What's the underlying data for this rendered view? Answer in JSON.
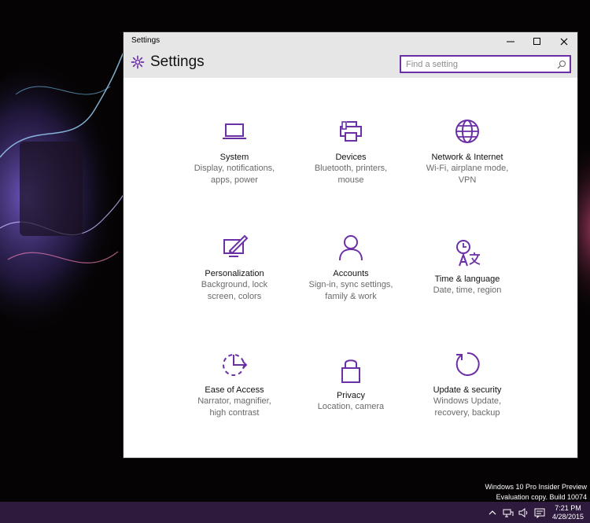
{
  "window": {
    "title": "Settings",
    "header_title": "Settings",
    "search_placeholder": "Find a setting",
    "controls": [
      "minimize-icon",
      "maximize-icon",
      "close-icon"
    ]
  },
  "tiles": [
    {
      "name": "System",
      "desc1": "Display, notifications,",
      "desc2": "apps, power",
      "icon": "laptop-icon"
    },
    {
      "name": "Devices",
      "desc1": "Bluetooth, printers,",
      "desc2": "mouse",
      "icon": "printer-icon"
    },
    {
      "name": "Network & Internet",
      "desc1": "Wi-Fi, airplane mode,",
      "desc2": "VPN",
      "icon": "globe-icon"
    },
    {
      "name": "Personalization",
      "desc1": "Background, lock",
      "desc2": "screen, colors",
      "icon": "paint-icon"
    },
    {
      "name": "Accounts",
      "desc1": "Sign-in, sync settings,",
      "desc2": "family & work",
      "icon": "person-icon"
    },
    {
      "name": "Time & language",
      "desc1": "Date, time, region",
      "desc2": "",
      "icon": "clock-language-icon"
    },
    {
      "name": "Ease of Access",
      "desc1": "Narrator, magnifier,",
      "desc2": "high contrast",
      "icon": "ease-of-access-icon"
    },
    {
      "name": "Privacy",
      "desc1": "Location, camera",
      "desc2": "",
      "icon": "lock-icon"
    },
    {
      "name": "Update & security",
      "desc1": "Windows Update,",
      "desc2": "recovery, backup",
      "icon": "refresh-icon"
    }
  ],
  "watermark": {
    "line1": "Windows 10 Pro Insider Preview",
    "line2": "Evaluation copy. Build 10074"
  },
  "taskbar": {
    "time": "7:21 PM",
    "date": "4/28/2015",
    "tray_icons": [
      "chevron-up-icon",
      "network-icon",
      "volume-icon",
      "action-center-icon"
    ]
  },
  "colors": {
    "accent": "#6b2fa6",
    "icon_purple": "#6b2fa6",
    "taskbar": "#2e1a3d",
    "titlebar": "#e6e6e6"
  }
}
